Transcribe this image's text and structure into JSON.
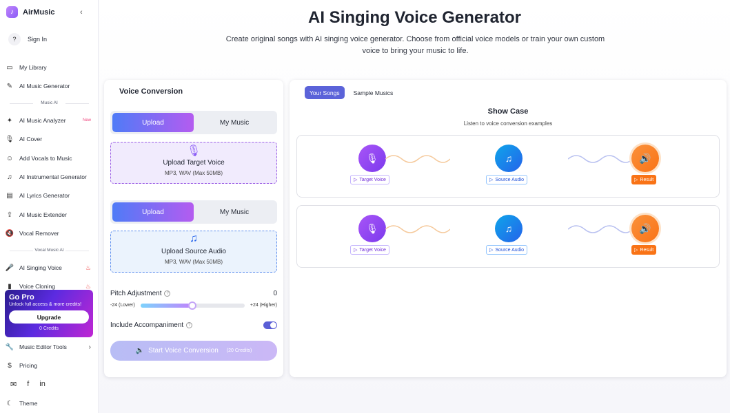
{
  "brand": {
    "name": "AirMusic"
  },
  "sidebar": {
    "sign_in": "Sign In",
    "items": [
      {
        "label": "My Library"
      },
      {
        "label": "AI Music Generator"
      },
      {
        "label": "AI Music Analyzer",
        "badge": "New"
      },
      {
        "label": "AI Cover"
      },
      {
        "label": "Add Vocals to Music"
      },
      {
        "label": "AI Instrumental Generator"
      },
      {
        "label": "AI Lyrics Generator"
      },
      {
        "label": "AI Music Extender"
      },
      {
        "label": "Vocal Remover"
      },
      {
        "label": "AI Singing Voice"
      },
      {
        "label": "Voice Cloning"
      },
      {
        "label": "Music Editor Tools"
      },
      {
        "label": "Pricing"
      },
      {
        "label": "Theme"
      }
    ],
    "sections": {
      "music_ai": "Music AI",
      "vocal_music_ai": "Vocal Music AI"
    },
    "gopro": {
      "title": "Go Pro",
      "subtitle": "Unlock full access & more credits!",
      "button": "Upgrade",
      "credits": "0 Credits"
    }
  },
  "main": {
    "title": "AI Singing Voice Generator",
    "description": "Create original songs with AI singing voice generator. Choose from official voice models or train your own custom voice to bring your music to life."
  },
  "conversion": {
    "title": "Voice Conversion",
    "upload_tab": "Upload",
    "mymusic_tab": "My Music",
    "target": {
      "title": "Upload Target Voice",
      "formats": "MP3, WAV (Max 50MB)"
    },
    "source": {
      "title": "Upload Source Audio",
      "formats": "MP3, WAV (Max 50MB)"
    },
    "pitch": {
      "label": "Pitch Adjustment",
      "value": "0",
      "min_label": "-24 (Lower)",
      "max_label": "+24 (Higher)",
      "position": 0.5
    },
    "accompaniment": {
      "label": "Include Accompaniment",
      "enabled": true
    },
    "start": {
      "label": "Start Voice Conversion",
      "credits": "(20 Credits)"
    }
  },
  "showcase": {
    "tabs": [
      "Your Songs",
      "Sample Musics"
    ],
    "title": "Show Case",
    "subtitle": "Listen to voice conversion examples",
    "labels": {
      "target": "Target Voice",
      "source": "Source Audio",
      "result": "Result"
    }
  },
  "colors": {
    "accent": "#5b63d9",
    "voice": "#7c3aed",
    "source": "#2563eb",
    "result": "#f97316"
  }
}
